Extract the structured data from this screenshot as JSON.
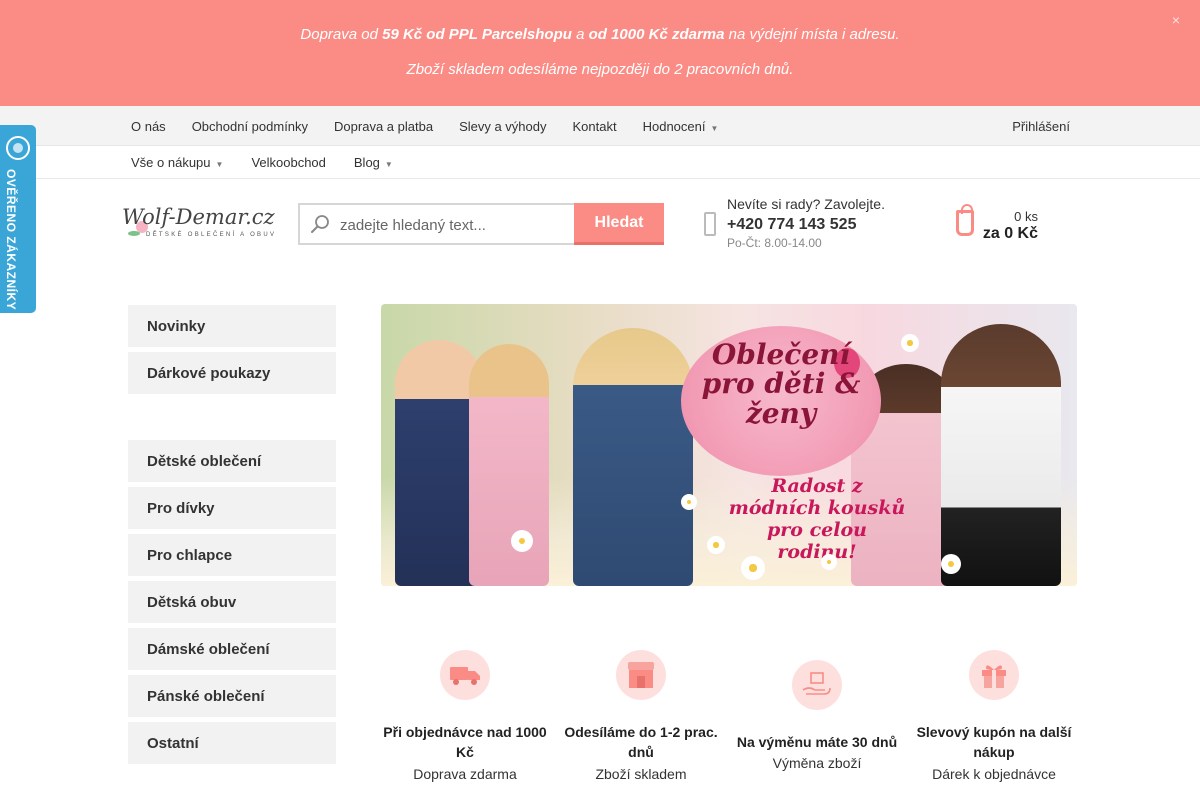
{
  "promo": {
    "line1_pre": "Doprava od ",
    "line1_b1": "59 Kč od PPL Parcelshopu",
    "line1_mid": " a ",
    "line1_b2": "od 1000 Kč zdarma",
    "line1_post": " na výdejní místa i adresu.",
    "line2": "Zboží skladem odesíláme nejpozději do 2 pracovních dnů.",
    "close_icon": "×"
  },
  "topnav": {
    "items": [
      "O nás",
      "Obchodní podmínky",
      "Doprava a platba",
      "Slevy a výhody",
      "Kontakt",
      "Hodnocení"
    ],
    "caret": "▼",
    "search_icon": "",
    "user_icon": "",
    "login": "Přihlášení"
  },
  "subnav": {
    "items": [
      "Vše o nákupu",
      "Velkoobchod",
      "Blog"
    ],
    "caret": "▼"
  },
  "trust_badge": {
    "text": "OVĚŘENO ZÁKAZNÍKY"
  },
  "header": {
    "logo_name": "Wolf-Demar.cz",
    "logo_tag": "dětské oblečení a obuv",
    "search_placeholder": "zadejte hledaný text...",
    "search_button": "Hledat",
    "phone_question": "Nevíte si rady? Zavolejte.",
    "phone_number": "+420 774 143 525",
    "phone_hours": "Po-Čt: 8.00-14.00",
    "phone_icon": "",
    "cart_count": "0 ks",
    "cart_price": "za 0 Kč",
    "cart_icon": ""
  },
  "sidebar": {
    "top": [
      "Novinky",
      "Dárkové poukazy"
    ],
    "categories": [
      "Dětské oblečení",
      "Pro dívky",
      "Pro chlapce",
      "Dětská obuv",
      "Dámské oblečení",
      "Pánské oblečení",
      "Ostatní"
    ],
    "arrow": ""
  },
  "hero": {
    "title": "Oblečení pro děti & ženy",
    "subtitle": "Radost z módních kousků pro celou rodinu!"
  },
  "features": [
    {
      "icon": "truck-icon",
      "title": "Při objednávce nad 1000 Kč",
      "desc": "Doprava zdarma"
    },
    {
      "icon": "store-icon",
      "title": "Odesíláme do 1-2 prac. dnů",
      "desc": "Zboží skladem"
    },
    {
      "icon": "exchange-icon",
      "title": "Na výměnu máte 30 dnů",
      "desc": "Výměna zboží"
    },
    {
      "icon": "gift-icon",
      "title": "Slevový kupón na další nákup",
      "desc": "Dárek k objednávce"
    }
  ],
  "colors": {
    "accent": "#fb8c85",
    "trust_blue": "#3aa6d8",
    "feature_circle": "#fde0de"
  }
}
